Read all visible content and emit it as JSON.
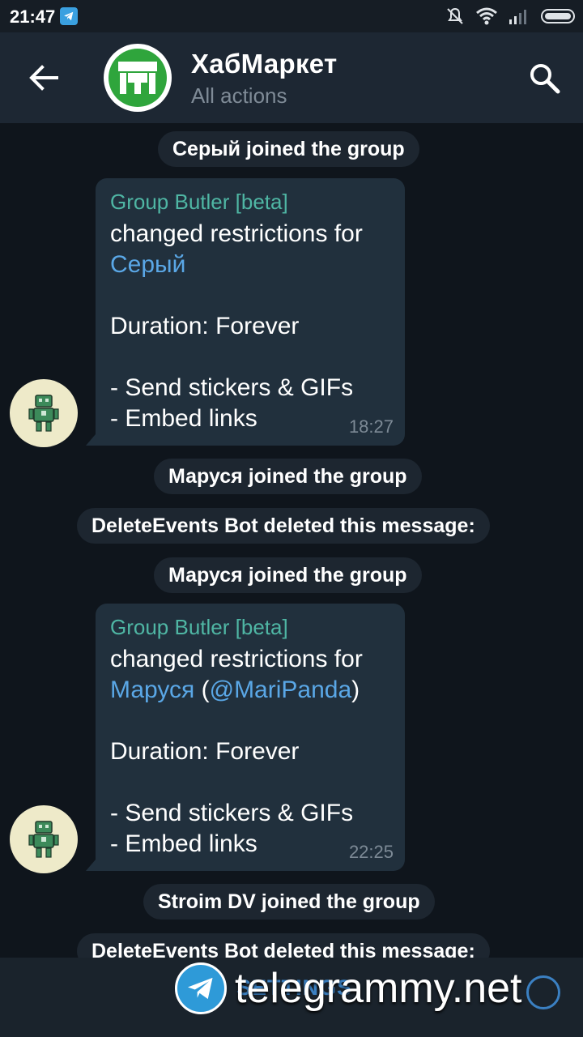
{
  "status": {
    "time": "21:47"
  },
  "header": {
    "title": "ХабМаркет",
    "subtitle": "All actions"
  },
  "events": {
    "e1": "Серый joined the group",
    "e2": "Маруся joined the group",
    "e3": "DeleteEvents Bot deleted this message:",
    "e4": "Маруся joined the group",
    "e5": "Stroim DV joined the group",
    "e6": "DeleteEvents Bot deleted this message:"
  },
  "messages": {
    "m1": {
      "sender": "Group Butler [beta]",
      "line1": "changed restrictions for",
      "mention": "Серый",
      "duration": "Duration: Forever",
      "r1": "- Send stickers & GIFs",
      "r2": "- Embed links",
      "time": "18:27"
    },
    "m2": {
      "sender": "Group Butler [beta]",
      "line1": "changed restrictions for",
      "mention": "Маруся",
      "open": " (",
      "username": "@MariPanda",
      "close": ")",
      "duration": "Duration: Forever",
      "r1": "- Send stickers & GIFs",
      "r2": "- Embed links",
      "time": "22:25"
    }
  },
  "bottom": {
    "settings_label": "SETTINGS"
  },
  "watermark": {
    "text": "telegrammy.net"
  },
  "icons": {
    "back": "arrow-left-icon",
    "search": "search-icon",
    "avatar": "shop-icon",
    "bot": "robot-icon"
  },
  "colors": {
    "background": "#0f151c",
    "appbar": "#1d2733",
    "bubble": "#21303d",
    "sender": "#4fb6a4",
    "link": "#5aa7e6"
  }
}
